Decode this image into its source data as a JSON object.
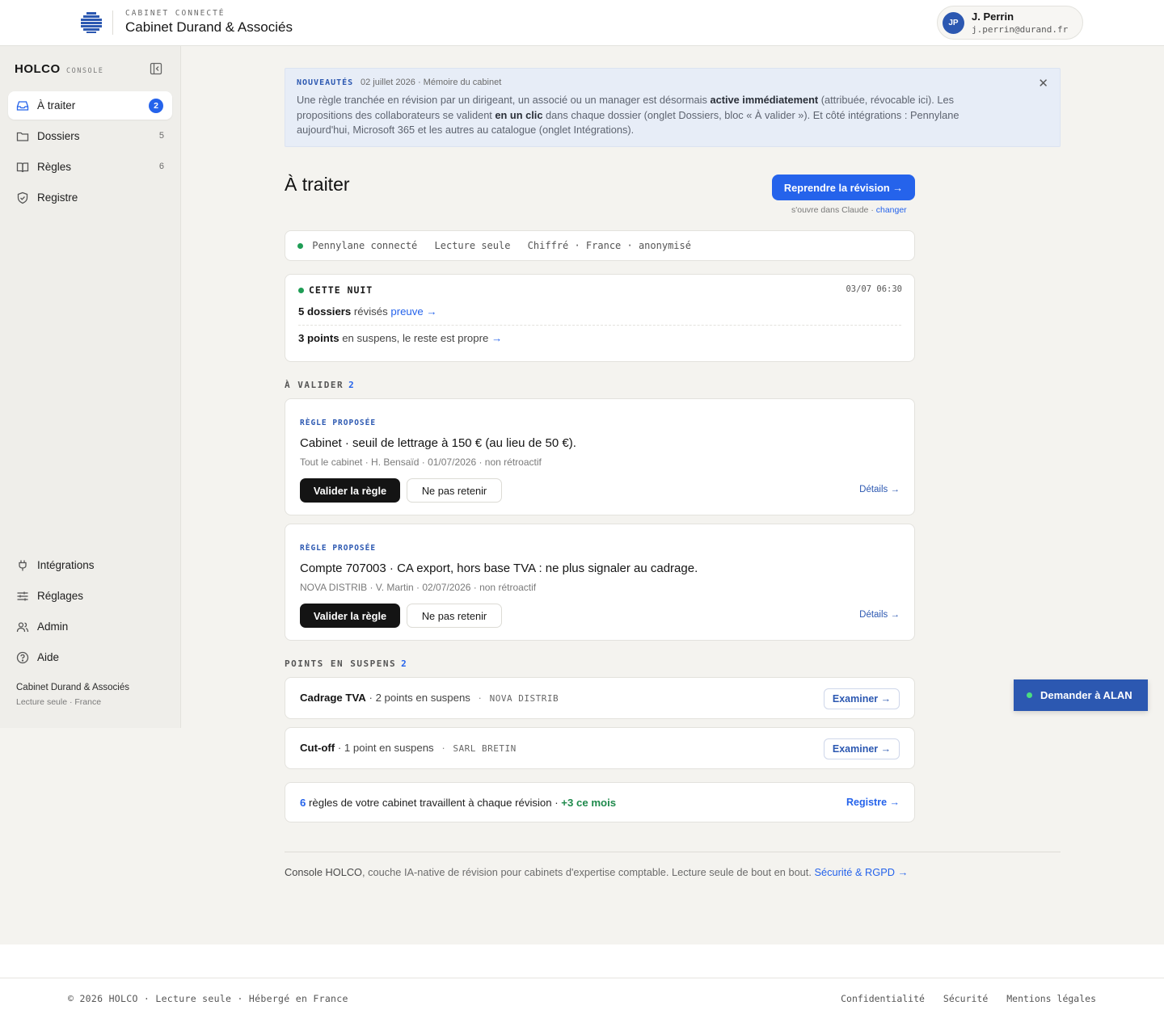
{
  "header": {
    "kicker": "CABINET CONNECTÉ",
    "firm_name": "Cabinet Durand & Associés",
    "user": {
      "initials": "JP",
      "name": "J. Perrin",
      "email": "j.perrin@durand.fr"
    }
  },
  "sidebar": {
    "title": "HOLCO",
    "subtitle": "CONSOLE",
    "nav": [
      {
        "label": "À traiter",
        "badge": "2",
        "icon": "inbox-icon",
        "active": true
      },
      {
        "label": "Dossiers",
        "count": "5",
        "icon": "folder-icon"
      },
      {
        "label": "Règles",
        "count": "6",
        "icon": "book-icon"
      },
      {
        "label": "Registre",
        "icon": "shield-check-icon"
      }
    ],
    "bottom_nav": [
      {
        "label": "Intégrations",
        "icon": "plug-icon"
      },
      {
        "label": "Réglages",
        "icon": "sliders-icon"
      },
      {
        "label": "Admin",
        "icon": "users-icon"
      },
      {
        "label": "Aide",
        "icon": "help-circle-icon"
      }
    ],
    "footer": {
      "name": "Cabinet Durand & Associés",
      "sub": "Lecture seule · France"
    }
  },
  "news": {
    "tag": "NOUVEAUTÉS",
    "date": "02 juillet 2026 · Mémoire du cabinet",
    "p1": "Une règle tranchée en révision par un dirigeant, un associé ou un manager est désormais ",
    "b1": "active immédiatement",
    "p2": " (attribuée, révocable ici). Les propositions des collaborateurs se valident ",
    "b2": "en un clic",
    "p3": " dans chaque dossier (onglet Dossiers, bloc « À valider »). Et côté intégrations : Pennylane aujourd'hui, Microsoft 365 et les autres au catalogue (onglet Intégrations).",
    "close": "✕"
  },
  "main": {
    "title": "À traiter",
    "resume_button": "Reprendre la révision →",
    "opens_in": "s'ouvre dans Claude ·",
    "change_link": "changer",
    "status": {
      "connected": "Pennylane connecté",
      "read_only": "Lecture seule",
      "security": "Chiffré · France · anonymisé"
    },
    "night": {
      "heading": "CETTE NUIT",
      "timestamp": "03/07 06:30",
      "dossiers_count": "5 dossiers",
      "dossiers_text": " révisés ",
      "proof_link": "preuve →",
      "points_count": "3 points",
      "points_text": " en suspens, le reste est propre ",
      "points_arrow": "→"
    },
    "to_validate": {
      "heading": "À VALIDER",
      "count": "2",
      "rules": [
        {
          "tag": "RÈGLE PROPOSÉE",
          "title": "Cabinet · seuil de lettrage à 150 € (au lieu de 50 €).",
          "meta": "Tout le cabinet · H. Bensaïd · 01/07/2026 · non rétroactif",
          "validate": "Valider la règle",
          "reject": "Ne pas retenir",
          "details": "Détails →"
        },
        {
          "tag": "RÈGLE PROPOSÉE",
          "title": "Compte 707003 · CA export, hors base TVA : ne plus signaler au cadrage.",
          "meta": "NOVA DISTRIB · V. Martin · 02/07/2026 · non rétroactif",
          "validate": "Valider la règle",
          "reject": "Ne pas retenir",
          "details": "Détails →"
        }
      ]
    },
    "pending": {
      "heading": "POINTS EN SUSPENS",
      "count": "2",
      "items": [
        {
          "name": "Cadrage TVA",
          "text": " · 2 points en suspens",
          "sep": "·",
          "client": "NOVA DISTRIB",
          "button": "Examiner →"
        },
        {
          "name": "Cut-off",
          "text": " · 1 point en suspens",
          "sep": "·",
          "client": "SARL BRETIN",
          "button": "Examiner →"
        }
      ]
    },
    "rules_summary": {
      "count": "6",
      "text": " règles de votre cabinet travaillent à chaque révision · ",
      "delta": "+3 ce mois",
      "link": "Registre →"
    },
    "footer": {
      "brand": "Console HOLCO",
      "text": ", couche IA-native de révision pour cabinets d'expertise comptable. Lecture seule de bout en bout. ",
      "link": "Sécurité & RGPD →"
    }
  },
  "assistant_button": "Demander à ALAN",
  "site_footer": {
    "left": "© 2026 HOLCO · Lecture seule · Hébergé en France",
    "links": [
      "Confidentialité",
      "Sécurité",
      "Mentions légales"
    ]
  },
  "colors": {
    "accent": "#2563eb",
    "brand": "#2c58b1",
    "status_ok": "#1f9d55",
    "background": "#f4f3ef"
  }
}
